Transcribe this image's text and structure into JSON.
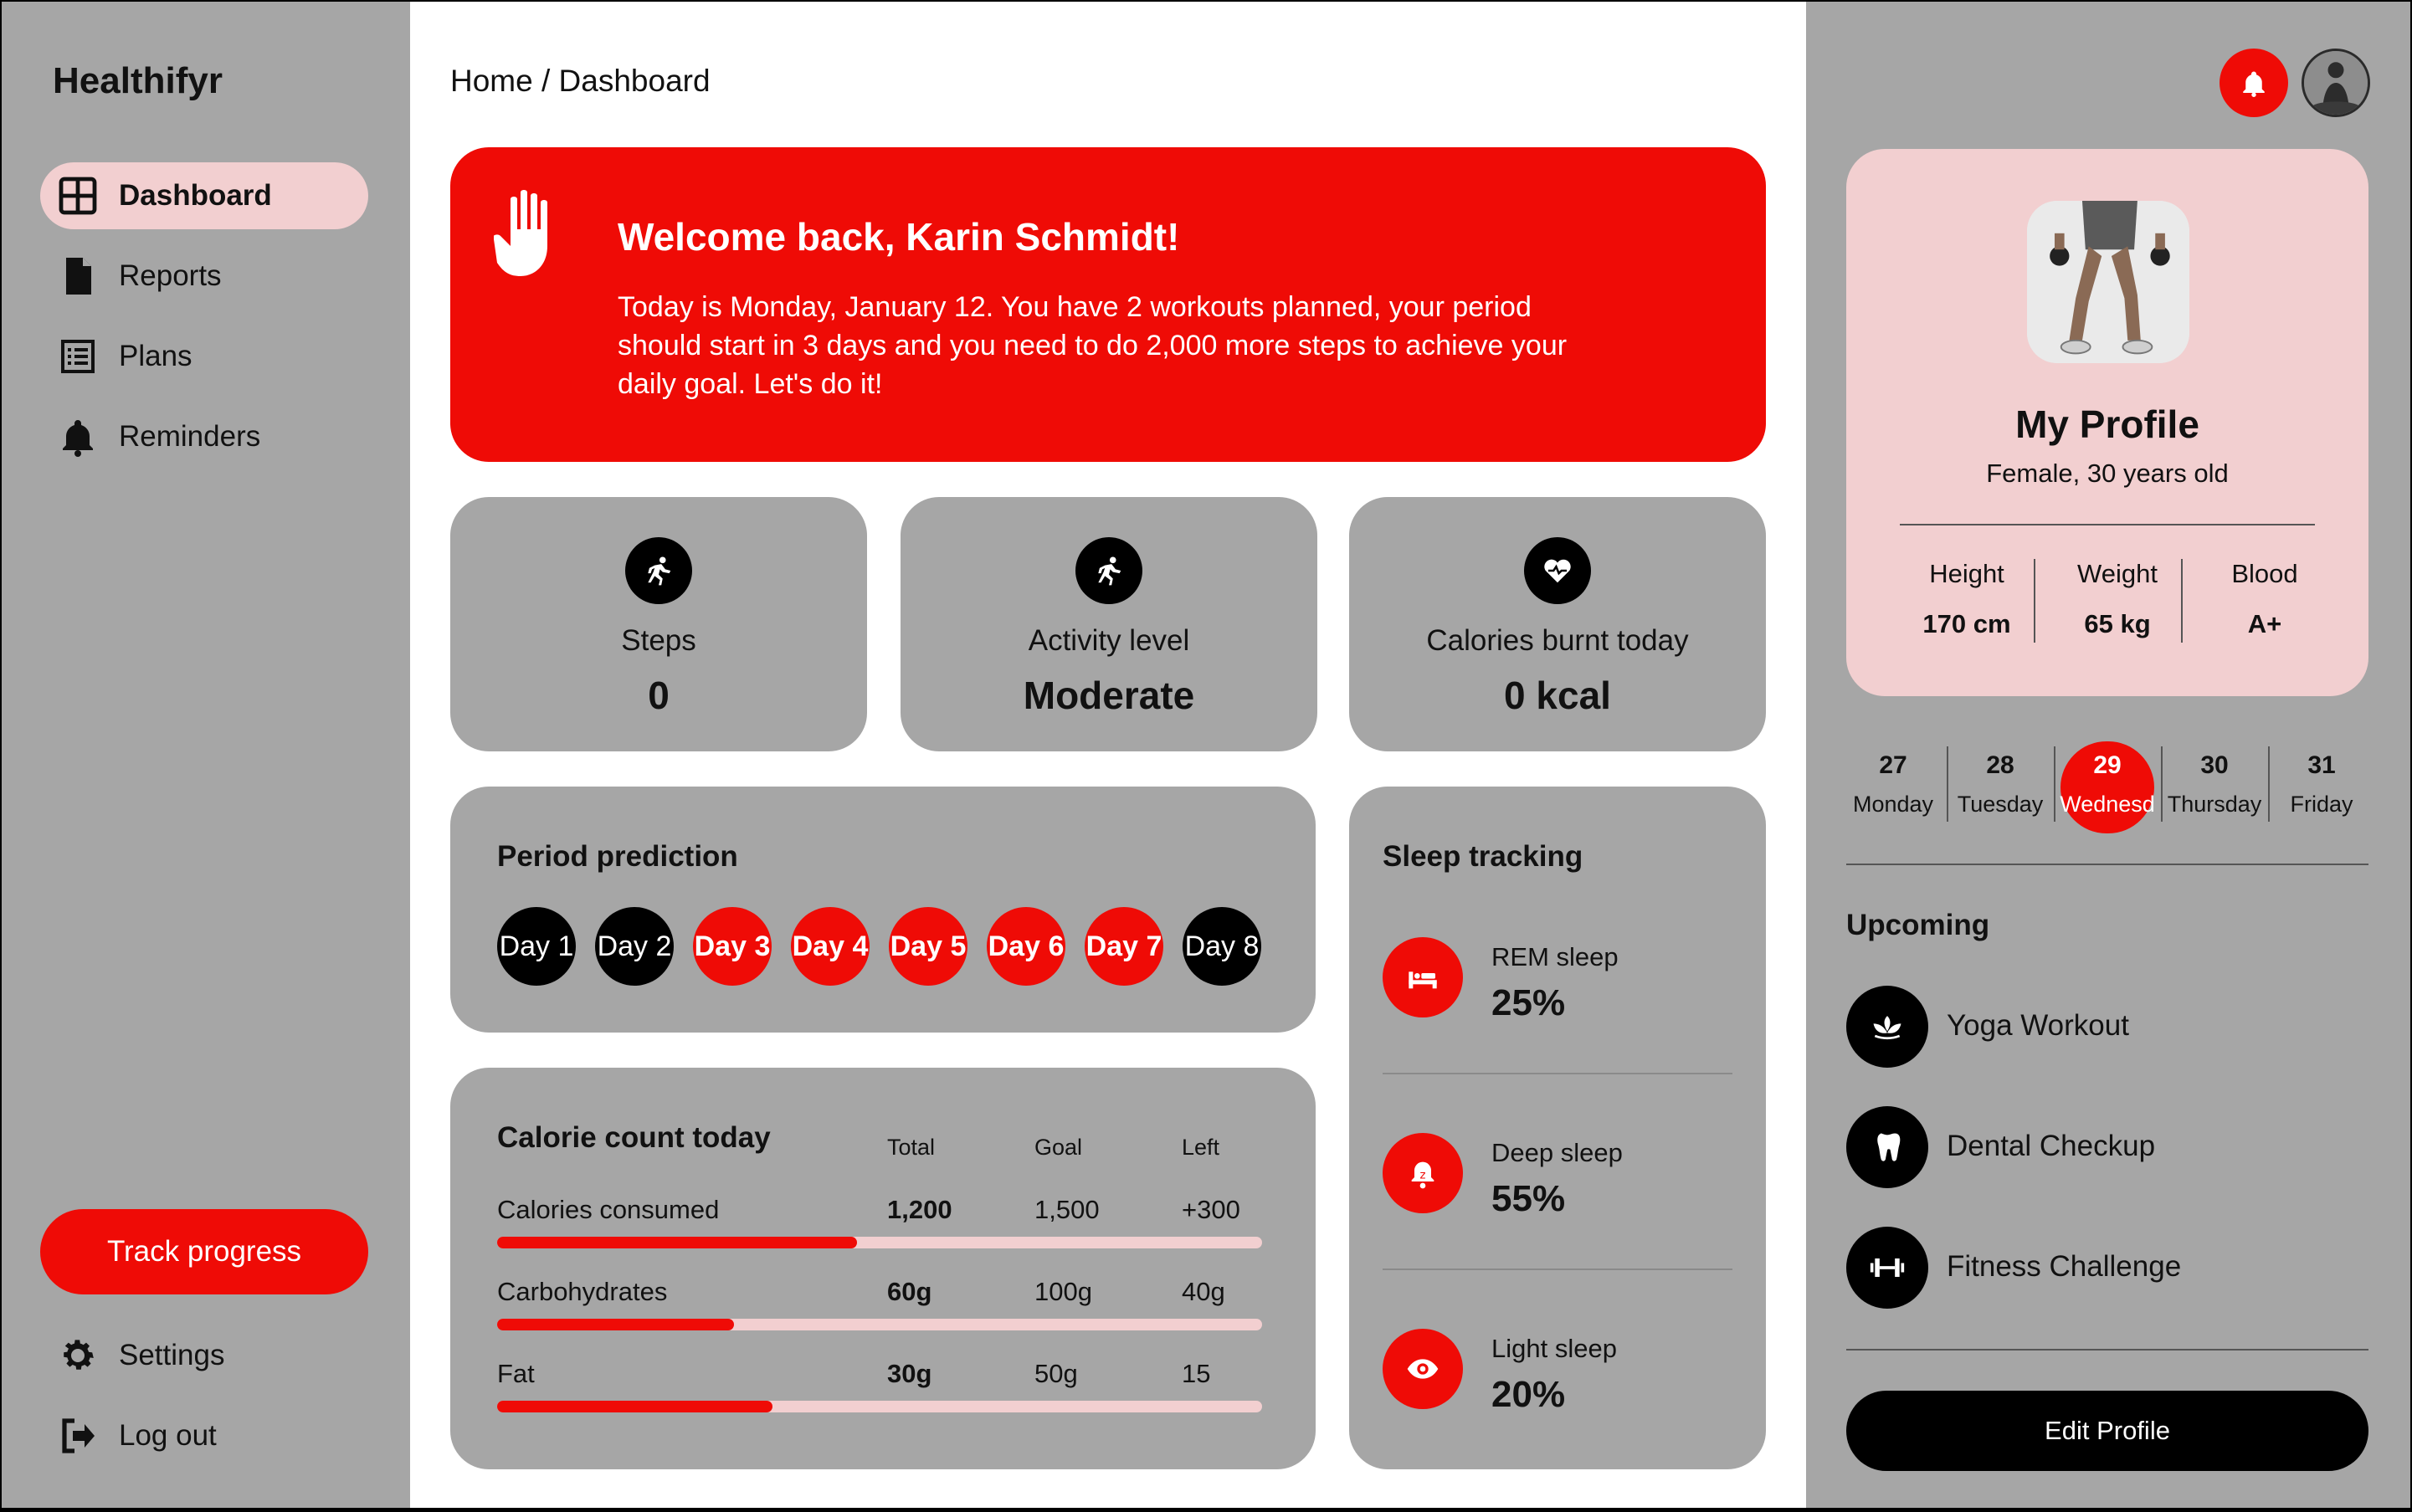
{
  "app": {
    "name": "Healthifyr"
  },
  "sidebar": {
    "items": [
      {
        "label": "Dashboard",
        "icon": "dashboard-grid-icon",
        "active": true
      },
      {
        "label": "Reports",
        "icon": "document-icon"
      },
      {
        "label": "Plans",
        "icon": "list-icon"
      },
      {
        "label": "Reminders",
        "icon": "bell-icon"
      }
    ],
    "track_label": "Track progress",
    "settings_label": "Settings",
    "logout_label": "Log out"
  },
  "breadcrumb": "Home / Dashboard",
  "welcome": {
    "title": "Welcome back, Karin Schmidt!",
    "message": "Today is Monday, January 12. You have 2 workouts planned, your period should start in 3 days and you need to do 2,000 more steps to achieve your daily goal. Let's do it!"
  },
  "stats": [
    {
      "label": "Steps",
      "value": "0",
      "icon": "running-icon"
    },
    {
      "label": "Activity level",
      "value": "Moderate",
      "icon": "running-icon"
    },
    {
      "label": "Calories burnt today",
      "value": "0 kcal",
      "icon": "heart-pulse-icon"
    }
  ],
  "period": {
    "title": "Period prediction",
    "days": [
      {
        "label": "Day 1",
        "predicted": false
      },
      {
        "label": "Day 2",
        "predicted": false
      },
      {
        "label": "Day 3",
        "predicted": true
      },
      {
        "label": "Day 4",
        "predicted": true
      },
      {
        "label": "Day 5",
        "predicted": true
      },
      {
        "label": "Day 6",
        "predicted": true
      },
      {
        "label": "Day 7",
        "predicted": true
      },
      {
        "label": "Day 8",
        "predicted": false
      }
    ]
  },
  "calories": {
    "title": "Calorie count today",
    "headers": [
      "Total",
      "Goal",
      "Left"
    ],
    "rows": [
      {
        "label": "Calories consumed",
        "total": "1,200",
        "goal": "1,500",
        "left": "+300",
        "progress": 0.47
      },
      {
        "label": "Carbohydrates",
        "total": "60g",
        "goal": "100g",
        "left": "40g",
        "progress": 0.31
      },
      {
        "label": "Fat",
        "total": "30g",
        "goal": "50g",
        "left": "15",
        "progress": 0.36
      }
    ]
  },
  "sleep": {
    "title": "Sleep tracking",
    "items": [
      {
        "label": "REM sleep",
        "value": "25%",
        "icon": "bed-icon"
      },
      {
        "label": "Deep sleep",
        "value": "55%",
        "icon": "alarm-icon"
      },
      {
        "label": "Light sleep",
        "value": "20%",
        "icon": "eye-icon"
      }
    ]
  },
  "profile": {
    "title": "My Profile",
    "subtitle": "Female, 30 years old",
    "stats": [
      {
        "label": "Height",
        "value": "170 cm"
      },
      {
        "label": "Weight",
        "value": "65 kg"
      },
      {
        "label": "Blood",
        "value": "A+"
      }
    ],
    "edit_label": "Edit Profile"
  },
  "calendar": [
    {
      "num": "27",
      "day": "Monday"
    },
    {
      "num": "28",
      "day": "Tuesday"
    },
    {
      "num": "29",
      "day": "Wednesd",
      "selected": true
    },
    {
      "num": "30",
      "day": "Thursday"
    },
    {
      "num": "31",
      "day": "Friday"
    }
  ],
  "upcoming": {
    "title": "Upcoming",
    "items": [
      {
        "label": "Yoga Workout",
        "icon": "lotus-icon"
      },
      {
        "label": "Dental Checkup",
        "icon": "tooth-icon"
      },
      {
        "label": "Fitness Challenge",
        "icon": "dumbbell-icon"
      }
    ]
  },
  "colors": {
    "accent": "#ef0b06",
    "panel": "#a6a6a6",
    "pink": "#f2cfd0"
  }
}
